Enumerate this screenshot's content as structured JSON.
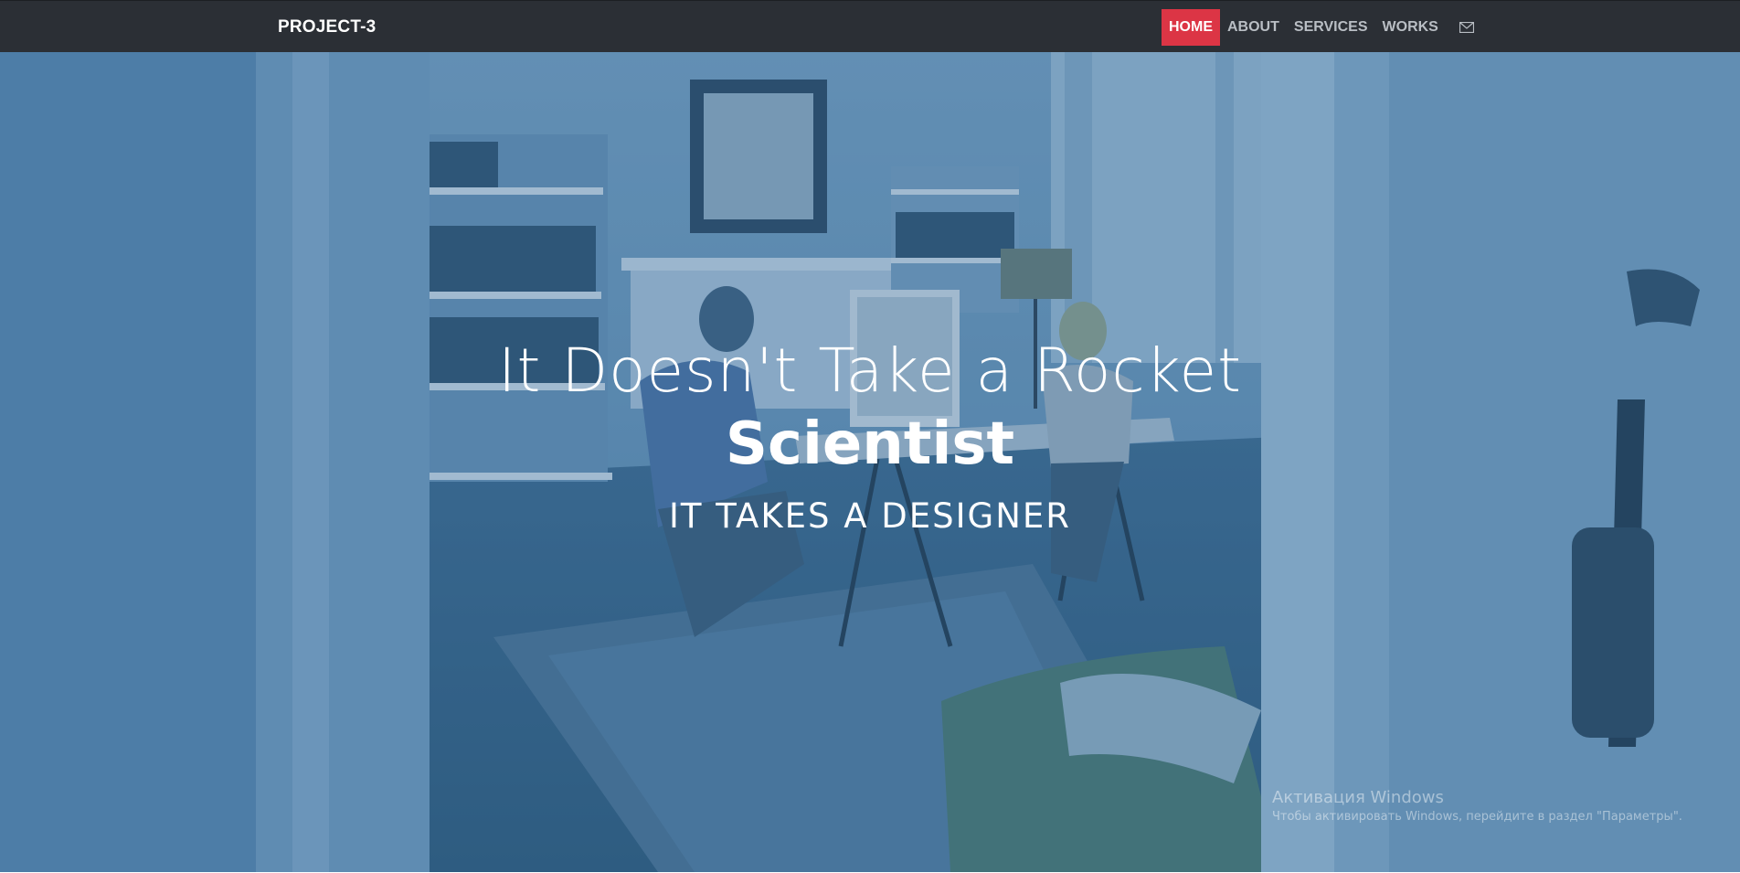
{
  "navbar": {
    "brand": "PROJECT-3",
    "items": [
      {
        "label": "HOME",
        "active": true
      },
      {
        "label": "ABOUT",
        "active": false
      },
      {
        "label": "SERVICES",
        "active": false
      },
      {
        "label": "WORKS",
        "active": false
      }
    ],
    "mail_icon": "mail-icon",
    "accent_color": "#dc3545",
    "background_color": "#2b2f35"
  },
  "hero": {
    "headline": "It Doesn't Take a Rocket",
    "headline_bold": "Scientist",
    "tagline": "IT TAKES A DESIGNER",
    "overlay_color": "#3d6f98"
  },
  "watermark": {
    "title": "Активация Windows",
    "subtitle": "Чтобы активировать Windows, перейдите в раздел \"Параметры\"."
  }
}
